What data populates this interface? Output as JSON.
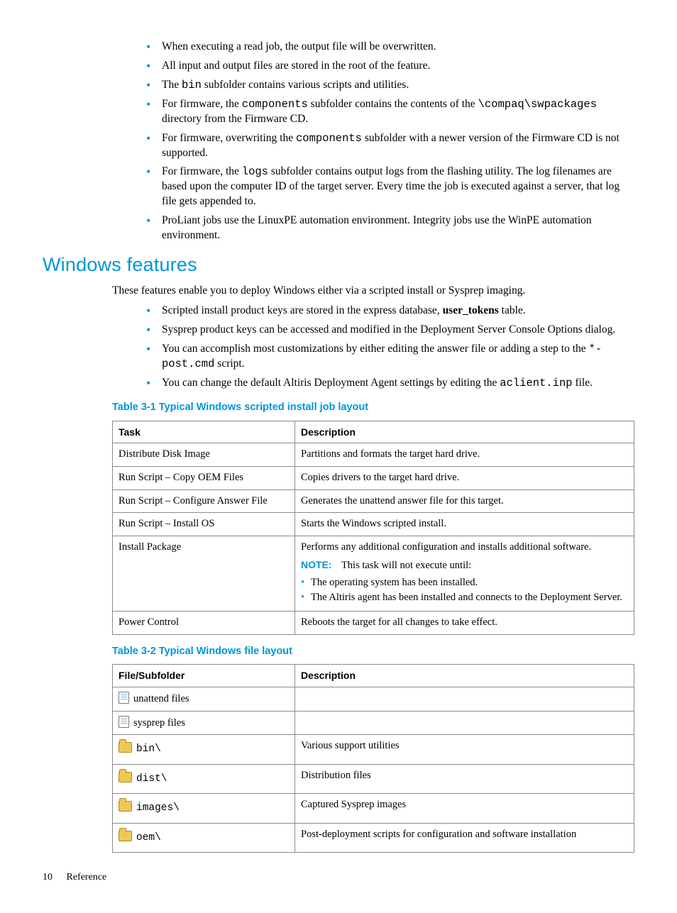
{
  "intro_bullets": [
    {
      "text": "When executing a read job, the output file will be overwritten."
    },
    {
      "text": "All input and output files are stored in the root of the feature."
    },
    {
      "segments": [
        {
          "t": "The "
        },
        {
          "t": "bin",
          "c": true
        },
        {
          "t": " subfolder contains various scripts and utilities."
        }
      ]
    },
    {
      "segments": [
        {
          "t": "For firmware, the "
        },
        {
          "t": "components",
          "c": true
        },
        {
          "t": " subfolder contains the contents of the "
        },
        {
          "t": "\\compaq\\swpackages",
          "c": true
        },
        {
          "t": " directory from the Firmware CD."
        }
      ]
    },
    {
      "segments": [
        {
          "t": "For firmware, overwriting the "
        },
        {
          "t": "components",
          "c": true
        },
        {
          "t": " subfolder with a newer version of the Firmware CD is not supported."
        }
      ]
    },
    {
      "segments": [
        {
          "t": "For firmware, the "
        },
        {
          "t": "logs",
          "c": true
        },
        {
          "t": " subfolder contains output logs from the flashing utility. The log filenames are based upon the computer ID of the target server. Every time the job is executed against a server, that log file gets appended to."
        }
      ]
    },
    {
      "text": "ProLiant jobs use the LinuxPE automation environment. Integrity jobs use the WinPE automation environment."
    }
  ],
  "section": {
    "title": "Windows features",
    "para": "These features enable you to deploy Windows either via a scripted install or Sysprep imaging.",
    "bullets": [
      {
        "segments": [
          {
            "t": "Scripted install product keys are stored in the express database, "
          },
          {
            "t": "user_tokens",
            "b": true
          },
          {
            "t": " table."
          }
        ]
      },
      {
        "text": "Sysprep product keys can be accessed and modified in the Deployment Server Console Options dialog."
      },
      {
        "segments": [
          {
            "t": "You can accomplish most customizations by either editing the answer file or adding a step to the "
          },
          {
            "t": "*-post.cmd",
            "c": true
          },
          {
            "t": " script."
          }
        ]
      },
      {
        "segments": [
          {
            "t": "You can change the default Altiris Deployment Agent settings by editing the "
          },
          {
            "t": "aclient.inp",
            "c": true
          },
          {
            "t": " file."
          }
        ]
      }
    ]
  },
  "table1": {
    "caption": "Table 3-1 Typical Windows scripted install job layout",
    "h1": "Task",
    "h2": "Description",
    "rows": [
      {
        "task": "Distribute Disk Image",
        "desc": "Partitions and formats the target hard drive."
      },
      {
        "task": "Run Script – Copy OEM Files",
        "desc": "Copies drivers to the target hard drive."
      },
      {
        "task": "Run Script – Configure Answer File",
        "desc": "Generates the unattend answer file for this target."
      },
      {
        "task": "Run Script – Install OS",
        "desc": "Starts the Windows scripted install."
      }
    ],
    "row5": {
      "task": "Install Package",
      "desc": "Performs any additional configuration and installs additional software.",
      "note_label": "NOTE:",
      "note_text": "This task will not execute until:",
      "sub": [
        "The operating system has been installed.",
        "The Altiris agent has been installed and connects to the Deployment Server."
      ]
    },
    "row6": {
      "task": "Power Control",
      "desc": "Reboots the target for all changes to take effect."
    }
  },
  "table2": {
    "caption": "Table 3-2 Typical Windows file layout",
    "h1": "File/Subfolder",
    "h2": "Description",
    "rows": [
      {
        "icon": "file",
        "name": "unattend files",
        "desc": ""
      },
      {
        "icon": "file",
        "name": "sysprep files",
        "desc": ""
      },
      {
        "icon": "folder",
        "name": "bin\\",
        "code": true,
        "desc": "Various support utilities"
      },
      {
        "icon": "folder",
        "name": "dist\\",
        "code": true,
        "desc": "Distribution files"
      },
      {
        "icon": "folder",
        "name": "images\\",
        "code": true,
        "desc": "Captured Sysprep images"
      },
      {
        "icon": "folder",
        "name": "oem\\",
        "code": true,
        "desc": "Post-deployment scripts for configuration and software installation"
      }
    ]
  },
  "footer": {
    "page": "10",
    "section": "Reference"
  }
}
